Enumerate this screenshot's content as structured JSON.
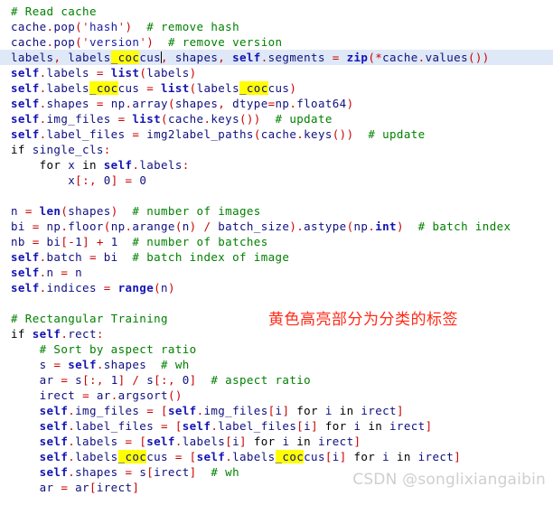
{
  "editor": {
    "language": "python",
    "background_color": "#ffffff",
    "current_line_highlight_color": "#dfe8f6",
    "search_highlight_color": "#ffff00",
    "comment_color": "#008000",
    "operator_color": "#cc0000",
    "keyword_color": "#1414b4",
    "current_line_number": 4,
    "search_term": "coc"
  },
  "code": {
    "lines": [
      "# Read cache",
      "cache.pop('hash')  # remove hash",
      "cache.pop('version')  # remove version",
      "labels, labels_coccus, shapes, self.segments = zip(*cache.values())",
      "self.labels = list(labels)",
      "self.labels_coccus = list(labels_coccus)",
      "self.shapes = np.array(shapes, dtype=np.float64)",
      "self.img_files = list(cache.keys())  # update",
      "self.label_files = img2label_paths(cache.keys())  # update",
      "if single_cls:",
      "    for x in self.labels:",
      "        x[:, 0] = 0",
      "",
      "n = len(shapes)  # number of images",
      "bi = np.floor(np.arange(n) / batch_size).astype(np.int)  # batch index",
      "nb = bi[-1] + 1  # number of batches",
      "self.batch = bi  # batch index of image",
      "self.n = n",
      "self.indices = range(n)",
      "",
      "# Rectangular Training",
      "if self.rect:",
      "    # Sort by aspect ratio",
      "    s = self.shapes  # wh",
      "    ar = s[:, 1] / s[:, 0]  # aspect ratio",
      "    irect = ar.argsort()",
      "    self.img_files = [self.img_files[i] for i in irect]",
      "    self.label_files = [self.label_files[i] for i in irect]",
      "    self.labels = [self.labels[i] for i in irect]",
      "    self.labels_coccus = [self.labels_coccus[i] for i in irect]",
      "    self.shapes = s[irect]  # wh",
      "    ar = ar[irect]"
    ]
  },
  "annotation": {
    "text": "黄色高亮部分为分类的标签",
    "color": "#ff2a18"
  },
  "watermark": {
    "text": "CSDN @songlixiangaibin",
    "color": "#cfcfcf"
  }
}
